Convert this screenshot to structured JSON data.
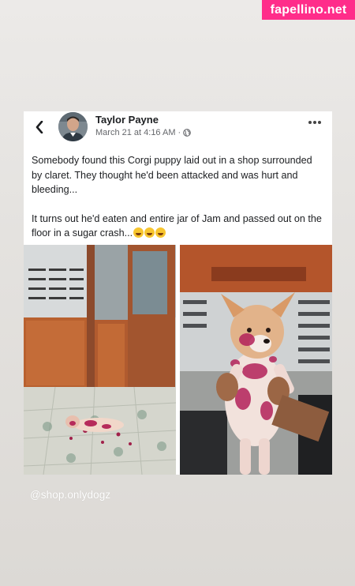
{
  "watermark": "fapellino.net",
  "post": {
    "author": "Taylor Payne",
    "timestamp": "March 21 at 4:16 AM",
    "privacy_icon": "globe-icon",
    "paragraph1": "Somebody found this Corgi puppy laid out in a shop surrounded by claret. They thought he'd been attacked and was hurt and bleeding...",
    "paragraph2": "It turns out he'd eaten and entire jar of Jam and passed out on the floor in a sugar crash...",
    "emojis": [
      "laughing-tears-emoji",
      "laughing-tears-emoji",
      "laughing-tears-emoji"
    ]
  },
  "caption": "@shop.onlydogz",
  "colors": {
    "watermark_bg": "#ff2d8a",
    "card_bg": "#ffffff",
    "page_bg": "#e4e2df"
  }
}
